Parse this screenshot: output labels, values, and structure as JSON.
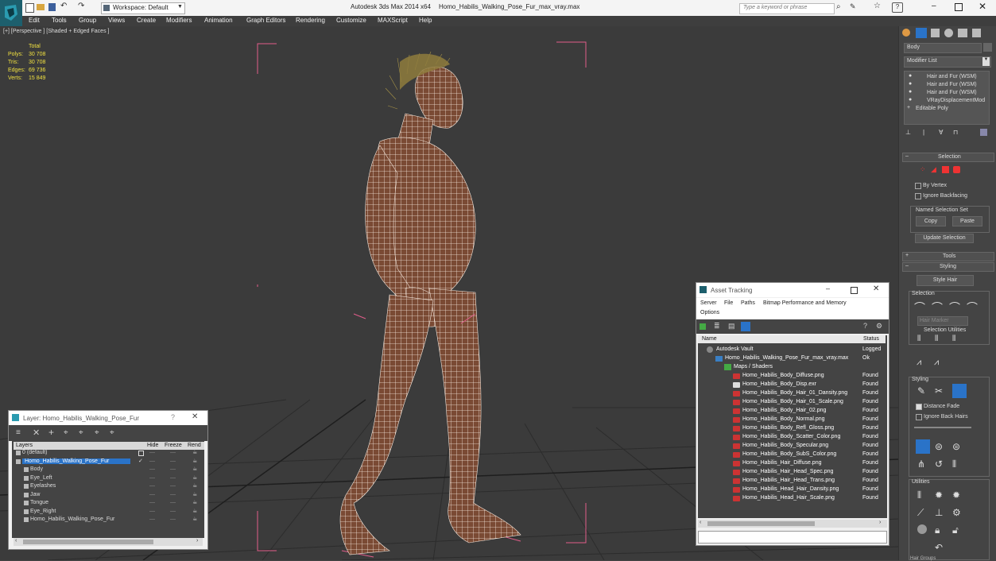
{
  "titlebar": {
    "workspace": "Workspace: Default",
    "app_title": "Autodesk 3ds Max  2014 x64",
    "file_title": "Homo_Habilis_Walking_Pose_Fur_max_vray.max",
    "search_placeholder": "Type a keyword or phrase"
  },
  "menu": [
    "Edit",
    "Tools",
    "Group",
    "Views",
    "Create",
    "Modifiers",
    "Animation",
    "Graph Editors",
    "Rendering",
    "Customize",
    "MAXScript",
    "Help"
  ],
  "viewport": {
    "label": "[+] [Perspective ] [Shaded + Edged Faces ]",
    "stats": {
      "header": "Total",
      "rows": [
        {
          "label": "Polys:",
          "value": "30 708"
        },
        {
          "label": "Tris:",
          "value": "30 708"
        },
        {
          "label": "Edges:",
          "value": "69 736"
        },
        {
          "label": "Verts:",
          "value": "15 849"
        }
      ]
    }
  },
  "command_panel": {
    "object_name": "Body",
    "modifier_list": "Modifier List",
    "stack": [
      "Hair and Fur (WSM)",
      "Hair and Fur (WSM)",
      "Hair and Fur (WSM)",
      "VRayDisplacementMod",
      "Editable Poly"
    ],
    "selection_title": "Selection",
    "by_vertex": "By Vertex",
    "ignore_backfacing": "Ignore Backfacing",
    "named_selection_set": "Named Selection Set",
    "copy": "Copy",
    "paste": "Paste",
    "update_selection": "Update Selection",
    "tools": "Tools",
    "styling": "Styling",
    "style_hair": "Style Hair",
    "selection_sub": "Selection",
    "hair_marker": "Hair Marker",
    "selection_utilities": "Selection Utilities",
    "styling_sub": "Styling",
    "distance_fade": "Distance Fade",
    "ignore_back_hairs": "Ignore Back Hairs",
    "utilities": "Utilities",
    "hair_groups": "Hair Groups"
  },
  "layer_window": {
    "title": "Layer: Homo_Habilis_Walking_Pose_Fur",
    "columns": [
      "Layers",
      "Hide",
      "Freeze",
      "Rend"
    ],
    "rows": [
      {
        "name": "0 (default)",
        "indent": 0,
        "selected": false
      },
      {
        "name": "Homo_Habilis_Walking_Pose_Fur",
        "indent": 0,
        "selected": true
      },
      {
        "name": "Body",
        "indent": 1,
        "selected": false
      },
      {
        "name": "Eye_Left",
        "indent": 1,
        "selected": false
      },
      {
        "name": "Eyelashes",
        "indent": 1,
        "selected": false
      },
      {
        "name": "Jaw",
        "indent": 1,
        "selected": false
      },
      {
        "name": "Tongue",
        "indent": 1,
        "selected": false
      },
      {
        "name": "Eye_Right",
        "indent": 1,
        "selected": false
      },
      {
        "name": "Homo_Habilis_Walking_Pose_Fur",
        "indent": 1,
        "selected": false
      }
    ]
  },
  "asset_window": {
    "title": "Asset Tracking",
    "menu": [
      "Server",
      "File",
      "Paths",
      "Bitmap Performance and Memory",
      "Options"
    ],
    "columns": [
      "Name",
      "Status"
    ],
    "rows": [
      {
        "name": "Autodesk Vault",
        "status": "Logged",
        "level": 0,
        "icon": "vault"
      },
      {
        "name": "Homo_Habilis_Walking_Pose_Fur_max_vray.max",
        "status": "Ok",
        "level": 1,
        "icon": "max"
      },
      {
        "name": "Maps / Shaders",
        "status": "",
        "level": 2,
        "icon": "maps"
      },
      {
        "name": "Homo_Habilis_Body_Diffuse.png",
        "status": "Found",
        "level": 3,
        "icon": "png"
      },
      {
        "name": "Homo_Habilis_Body_Disp.exr",
        "status": "Found",
        "level": 3,
        "icon": "exr"
      },
      {
        "name": "Homo_Habilis_Body_Hair_01_Dansity.png",
        "status": "Found",
        "level": 3,
        "icon": "png"
      },
      {
        "name": "Homo_Habilis_Body_Hair_01_Scale.png",
        "status": "Found",
        "level": 3,
        "icon": "png"
      },
      {
        "name": "Homo_Habilis_Body_Hair_02.png",
        "status": "Found",
        "level": 3,
        "icon": "png"
      },
      {
        "name": "Homo_Habilis_Body_Normal.png",
        "status": "Found",
        "level": 3,
        "icon": "png"
      },
      {
        "name": "Homo_Habilis_Body_Refl_Gloss.png",
        "status": "Found",
        "level": 3,
        "icon": "png"
      },
      {
        "name": "Homo_Habilis_Body_Scatter_Color.png",
        "status": "Found",
        "level": 3,
        "icon": "png"
      },
      {
        "name": "Homo_Habilis_Body_Specular.png",
        "status": "Found",
        "level": 3,
        "icon": "png"
      },
      {
        "name": "Homo_Habilis_Body_SubS_Color.png",
        "status": "Found",
        "level": 3,
        "icon": "png"
      },
      {
        "name": "Homo_Habilis_Hair_Diffuse.png",
        "status": "Found",
        "level": 3,
        "icon": "png"
      },
      {
        "name": "Homo_Habilis_Hair_Head_Spec.png",
        "status": "Found",
        "level": 3,
        "icon": "png"
      },
      {
        "name": "Homo_Habilis_Hair_Head_Trans.png",
        "status": "Found",
        "level": 3,
        "icon": "png"
      },
      {
        "name": "Homo_Habilis_Head_Hair_Dansity.png",
        "status": "Found",
        "level": 3,
        "icon": "png"
      },
      {
        "name": "Homo_Habilis_Head_Hair_Scale.png",
        "status": "Found",
        "level": 3,
        "icon": "png"
      }
    ]
  },
  "colors": {
    "viewport_bg": "#3b3b3b",
    "stats_text": "#f0e040",
    "bbox_pink": "#e05d8a",
    "mesh_wire": "#f4e7dc",
    "selection_blue": "#2a73c8"
  }
}
